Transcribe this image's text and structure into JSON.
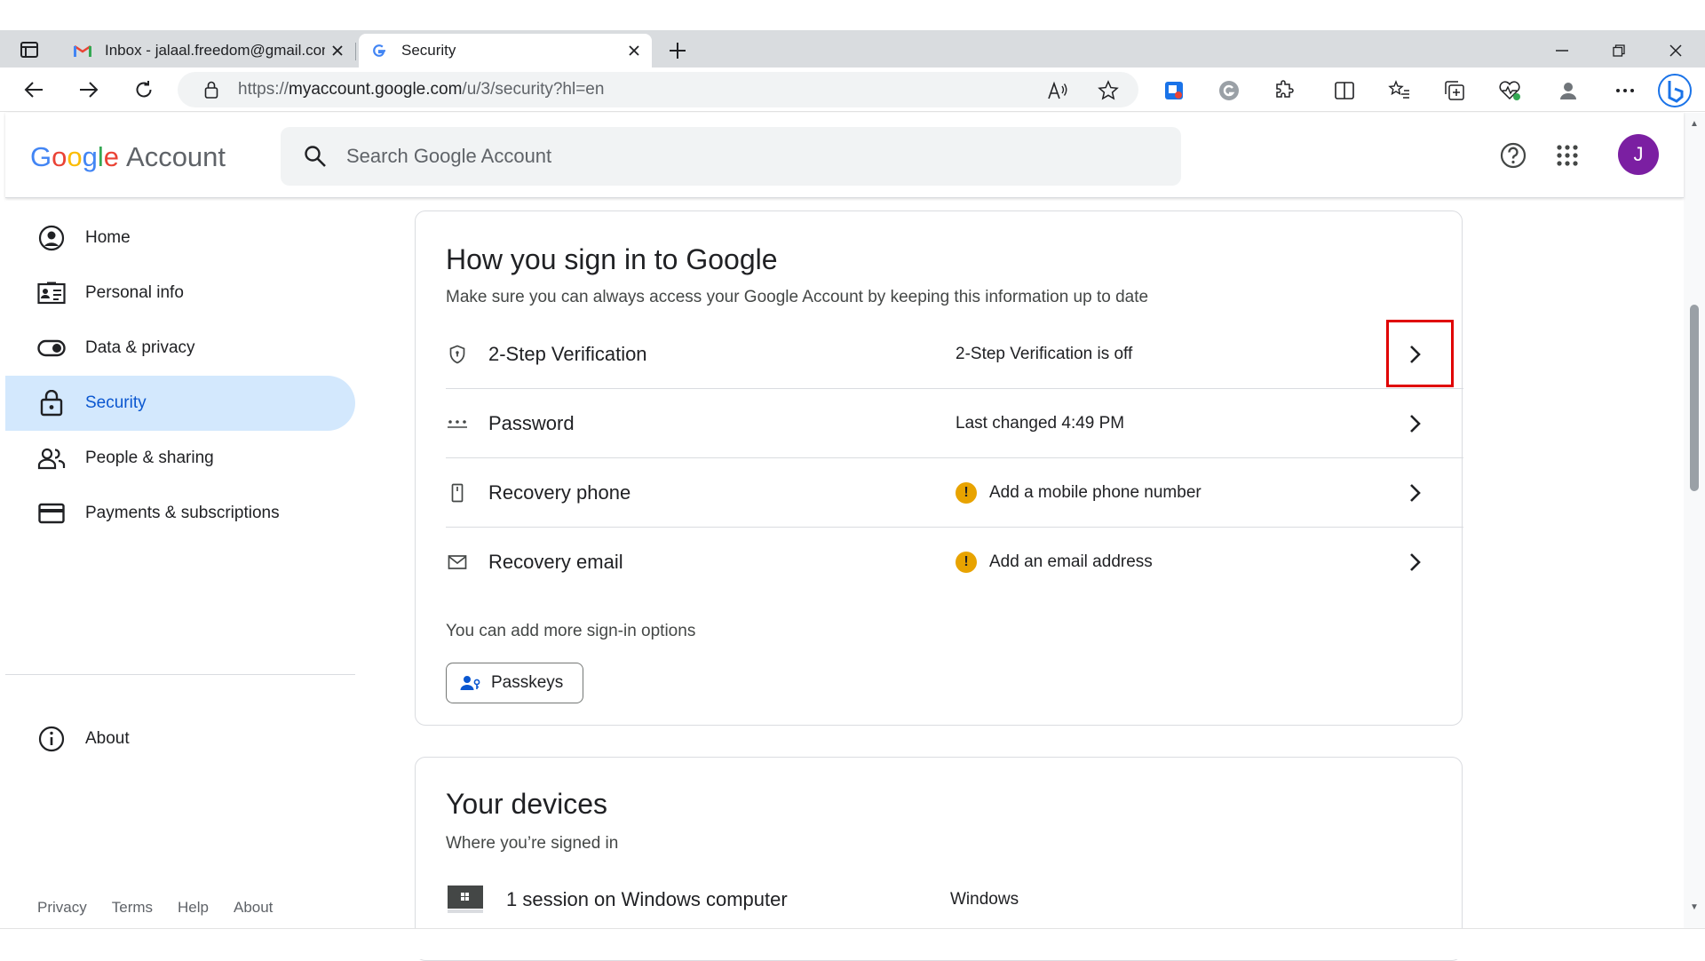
{
  "browser": {
    "tabs": [
      {
        "title": "Inbox - jalaal.freedom@gmail.com",
        "active": false,
        "favicon": "gmail-icon"
      },
      {
        "title": "Security",
        "active": true,
        "favicon": "google-g-icon"
      }
    ],
    "url_prefix": "https://",
    "url_host": "myaccount.google.com",
    "url_path": "/u/3/security?hl=en"
  },
  "header": {
    "logo_letters": [
      "G",
      "o",
      "o",
      "g",
      "l",
      "e"
    ],
    "logo_suffix": "Account",
    "search_placeholder": "Search Google Account",
    "avatar_letter": "J",
    "avatar_color": "#7b1fa2"
  },
  "sidebar": {
    "items": [
      {
        "label": "Home",
        "icon": "account-circle-icon"
      },
      {
        "label": "Personal info",
        "icon": "id-card-icon"
      },
      {
        "label": "Data & privacy",
        "icon": "toggle-icon"
      },
      {
        "label": "Security",
        "icon": "lock-icon",
        "active": true
      },
      {
        "label": "People & sharing",
        "icon": "people-icon"
      },
      {
        "label": "Payments & subscriptions",
        "icon": "credit-card-icon"
      },
      {
        "label": "About",
        "icon": "info-icon"
      }
    ],
    "footer": [
      "Privacy",
      "Terms",
      "Help",
      "About"
    ]
  },
  "signin_card": {
    "title": "How you sign in to Google",
    "subtitle": "Make sure you can always access your Google Account by keeping this information up to date",
    "rows": [
      {
        "label": "2-Step Verification",
        "value": "2-Step Verification is off",
        "icon": "shield-icon",
        "warning": false
      },
      {
        "label": "Password",
        "value": "Last changed 4:49 PM",
        "icon": "password-dots-icon",
        "warning": false
      },
      {
        "label": "Recovery phone",
        "value": "Add a mobile phone number",
        "icon": "phone-icon",
        "warning": true
      },
      {
        "label": "Recovery email",
        "value": "Add an email address",
        "icon": "mail-icon",
        "warning": true
      }
    ],
    "more_options": "You can add more sign-in options",
    "passkeys_label": "Passkeys",
    "warning_mark": "!"
  },
  "devices_card": {
    "title": "Your devices",
    "subtitle": "Where you’re signed in",
    "sessions": [
      {
        "label": "1 session on Windows computer",
        "value": "Windows"
      }
    ]
  },
  "colors": {
    "accent": "#0b57d0",
    "active_nav_bg": "#d3e8fd",
    "warning": "#e8a300",
    "highlight_box": "#e00000"
  }
}
